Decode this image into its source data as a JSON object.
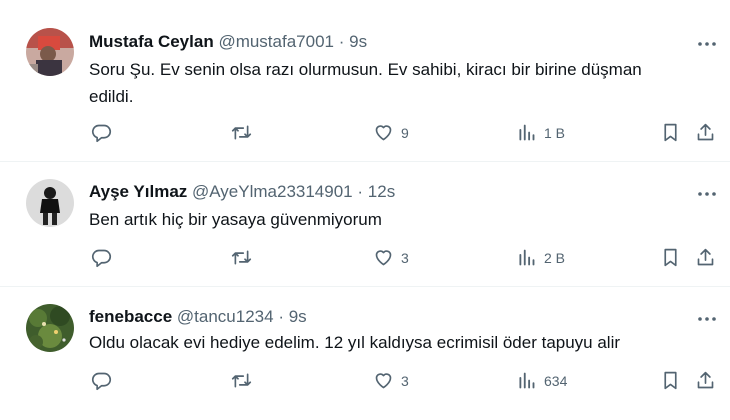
{
  "tweets": [
    {
      "name": "Mustafa Ceylan",
      "handle": "@mustafa7001",
      "separator": "·",
      "time": "9s",
      "text_line1": "Soru Şu. Ev senin olsa razı olurmusun. Ev sahibi, kiracı bir birine düşman",
      "text_line2": "edildi.",
      "likes": "9",
      "views": "1 B"
    },
    {
      "name": "Ayşe Yılmaz",
      "handle": "@AyeYlma23314901",
      "separator": "·",
      "time": "12s",
      "text_line1": "Ben artık hiç bir yasaya güvenmiyorum",
      "likes": "3",
      "views": "2 B"
    },
    {
      "name": "fenebacce",
      "handle": "@tancu1234",
      "separator": "·",
      "time": "9s",
      "text_line1": "Oldu olacak evi hediye edelim. 12 yıl kaldıysa ecrimisil öder tapuyu alir",
      "likes": "3",
      "views": "634"
    }
  ],
  "icons": {
    "reply": "reply-icon",
    "retweet": "retweet-icon",
    "like": "heart-icon",
    "views": "bar-chart-icon",
    "bookmark": "bookmark-icon",
    "share": "share-icon",
    "more": "more-dots-icon"
  },
  "colors": {
    "text": "#0f1419",
    "secondary": "#536471",
    "divider": "#eff3f4"
  }
}
